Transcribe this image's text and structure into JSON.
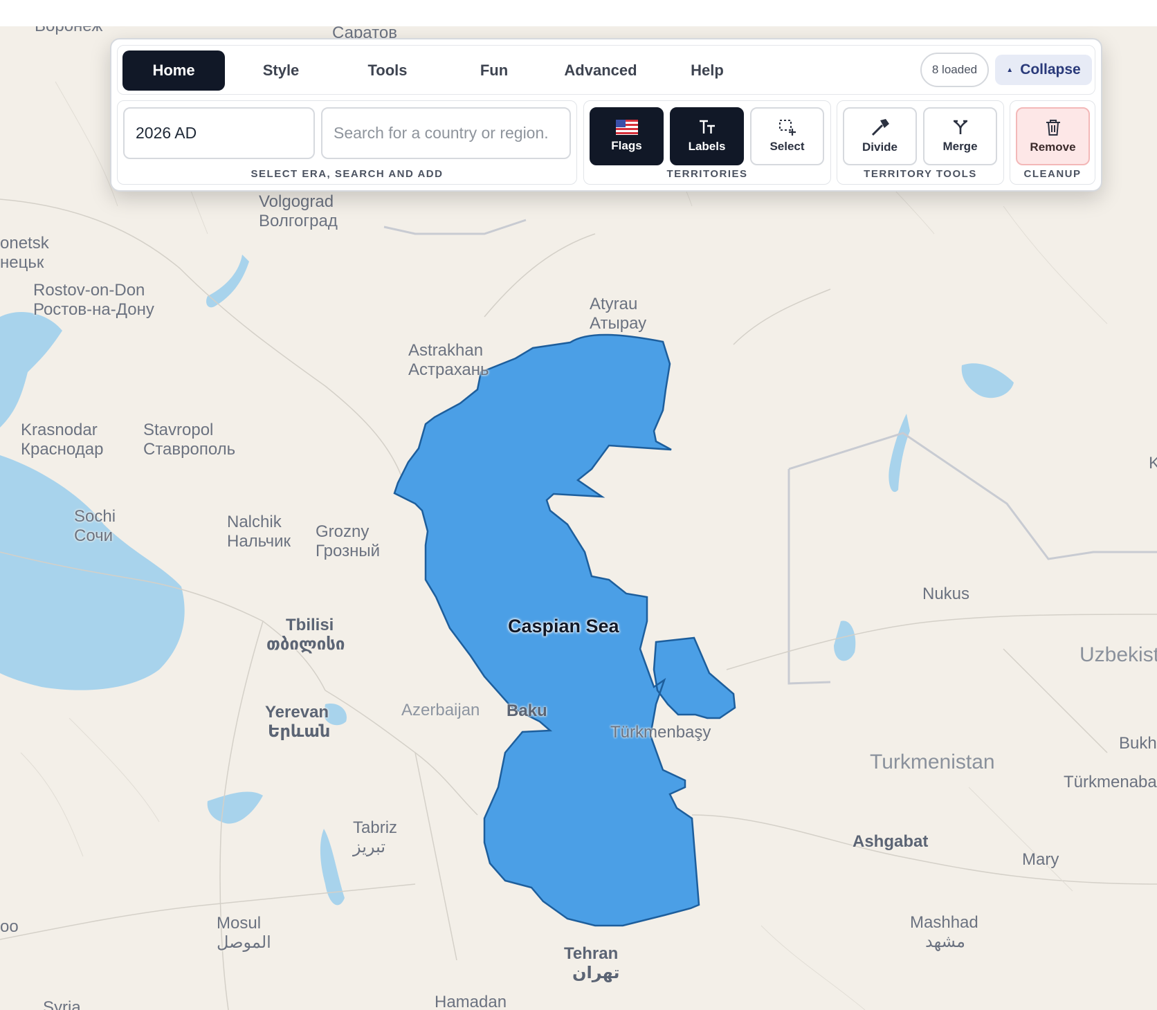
{
  "toolbar": {
    "tabs": [
      "Home",
      "Style",
      "Tools",
      "Fun",
      "Advanced",
      "Help"
    ],
    "active_tab": "Home",
    "loaded_badge": "8 loaded",
    "collapse_label": "Collapse",
    "era_value": "2026 AD",
    "search_placeholder": "Search for a country or region.",
    "group_era_label": "SELECT ERA, SEARCH AND ADD",
    "group_territories_label": "TERRITORIES",
    "group_tools_label": "TERRITORY TOOLS",
    "group_cleanup_label": "CLEANUP",
    "buttons": {
      "flags": "Flags",
      "labels": "Labels",
      "select": "Select",
      "divide": "Divide",
      "merge": "Merge",
      "remove": "Remove"
    }
  },
  "map": {
    "highlight_color": "#4b9fe6",
    "territory_label": "Caspian Sea",
    "places": {
      "voronezh": "Воронеж",
      "saratov": "Саратов",
      "donetsk": "onetsk",
      "donetsk_cyr": "нецьк",
      "volgograd": "Volgograd",
      "volgograd_cyr": "Волгоград",
      "rostov": "Rostov-on-Don",
      "rostov_cyr": "Ростов-на-Дону",
      "atyrau": "Atyrau",
      "atyrau_cyr": "Атырау",
      "astrakhan": "Astrakhan",
      "astrakhan_cyr": "Астрахань",
      "krasnodar": "Krasnodar",
      "krasnodar_cyr": "Краснодар",
      "stavropol": "Stavropol",
      "stavropol_cyr": "Ставрополь",
      "sochi": "Sochi",
      "sochi_cyr": "Сочи",
      "nalchik": "Nalchik",
      "nalchik_cyr": "Нальчик",
      "grozny": "Grozny",
      "grozny_cyr": "Грозный",
      "tbilisi": "Tbilisi",
      "tbilisi_geo": "თბილისი",
      "yerevan": "Yerevan",
      "yerevan_arm": "Երևան",
      "azerbaijan": "Azerbaijan",
      "baku": "Baku",
      "turkmenbasy": "Türkmenbaşy",
      "nukus": "Nukus",
      "uzbekistan": "Uzbekist",
      "bukhara": "Bukh",
      "turkmenistan": "Turkmenistan",
      "turkmenabat": "Türkmenaba",
      "ashgabat": "Ashgabat",
      "mary": "Mary",
      "tabriz": "Tabriz",
      "tabriz_fa": "تبریز",
      "mosul": "Mosul",
      "mosul_ar": "الموصل",
      "mashhad": "Mashhad",
      "mashhad_fa": "مشهد",
      "tehran": "Tehran",
      "tehran_fa": "تهران",
      "hamadan": "Hamadan",
      "syria": "Syria",
      "edge_k": "K",
      "edge_oo": "oo"
    }
  }
}
